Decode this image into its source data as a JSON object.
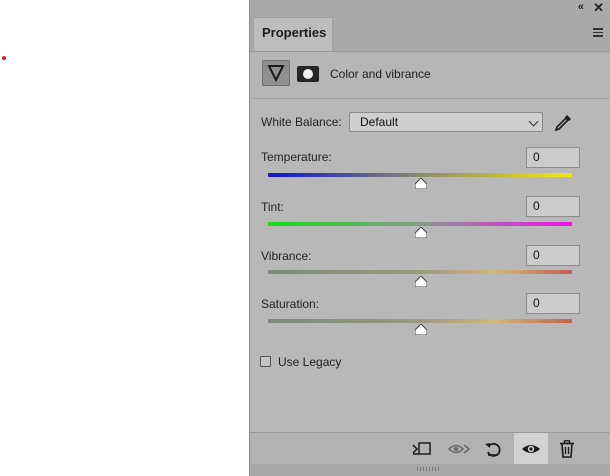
{
  "panel": {
    "tab_title": "Properties",
    "header_title": "Color and vibrance"
  },
  "white_balance": {
    "label": "White Balance:",
    "selected": "Default"
  },
  "sliders": [
    {
      "label": "Temperature:",
      "value": "0"
    },
    {
      "label": "Tint:",
      "value": "0"
    },
    {
      "label": "Vibrance:",
      "value": "0"
    },
    {
      "label": "Saturation:",
      "value": "0"
    }
  ],
  "legacy": {
    "label": "Use Legacy",
    "checked": false
  },
  "footer_icons": [
    "clip-to-layer-icon",
    "view-previous-state-icon",
    "reset-icon",
    "visibility-eye-icon",
    "trash-icon"
  ],
  "colors": {
    "panel_bg": "#b8b8b8",
    "temperature_gradient": [
      "#1010d0",
      "#ecec10"
    ],
    "tint_gradient": [
      "#10e010",
      "#f010f0"
    ],
    "vibrance_gradient": [
      "#7a8a7a",
      "#d4b67a",
      "#c06050"
    ]
  }
}
